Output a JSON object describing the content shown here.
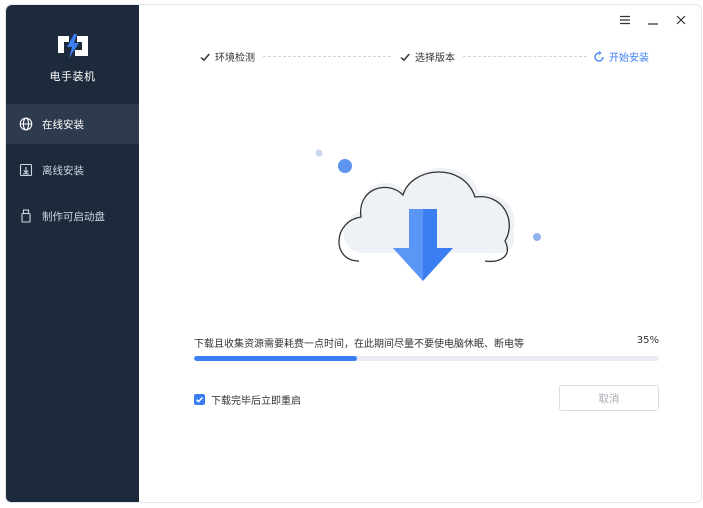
{
  "app": {
    "title": "电手装机"
  },
  "sidebar": {
    "items": [
      {
        "label": "在线安装",
        "icon": "globe-icon",
        "active": true
      },
      {
        "label": "离线安装",
        "icon": "offline-download-icon",
        "active": false
      },
      {
        "label": "制作可启动盘",
        "icon": "usb-drive-icon",
        "active": false
      }
    ]
  },
  "window_controls": {
    "menu": "menu-icon",
    "minimize": "minimize-icon",
    "close": "close-icon"
  },
  "steps": [
    {
      "label": "环境检测",
      "status": "done"
    },
    {
      "label": "选择版本",
      "status": "done"
    },
    {
      "label": "开始安装",
      "status": "in-progress"
    }
  ],
  "progress": {
    "message": "下载且收集资源需要耗费一点时间，在此期间尽量不要使电脑休眠、断电等",
    "percent_label": "35%",
    "value": 0.35
  },
  "options": {
    "restart_label": "下载完毕后立即重启",
    "restart_checked": true
  },
  "buttons": {
    "cancel": "取消"
  },
  "colors": {
    "sidebar": "#1d2a3b",
    "accent": "#3a7ef2",
    "sidebar_active": "#2e3b4e"
  }
}
